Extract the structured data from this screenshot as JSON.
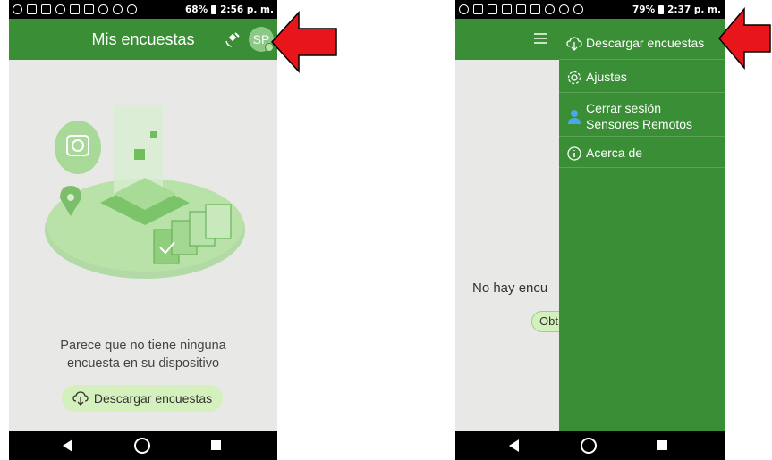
{
  "left_screen": {
    "status": {
      "battery": "68%",
      "time": "2:56 p. m."
    },
    "title": "Mis encuestas",
    "avatar_initials": "SP",
    "empty_message_line1": "Parece que no tiene ninguna",
    "empty_message_line2": "encuesta en su dispositivo",
    "download_button": "Descargar encuestas"
  },
  "right_screen": {
    "status": {
      "battery": "79%",
      "time": "2:37 p. m."
    },
    "menu": [
      {
        "icon": "cloud-download-icon",
        "label": "Descargar encuestas"
      },
      {
        "icon": "gear-icon",
        "label": "Ajustes"
      },
      {
        "icon": "user-icon",
        "label": "Cerrar sesión",
        "sublabel": "Sensores Remotos"
      },
      {
        "icon": "info-icon",
        "label": "Acerca de"
      }
    ],
    "behind_text": "No hay encu",
    "behind_button": "Obt"
  },
  "colors": {
    "appbar": "#3a8e35",
    "accent": "#d4f0bd",
    "arrow": "#e8161b"
  }
}
